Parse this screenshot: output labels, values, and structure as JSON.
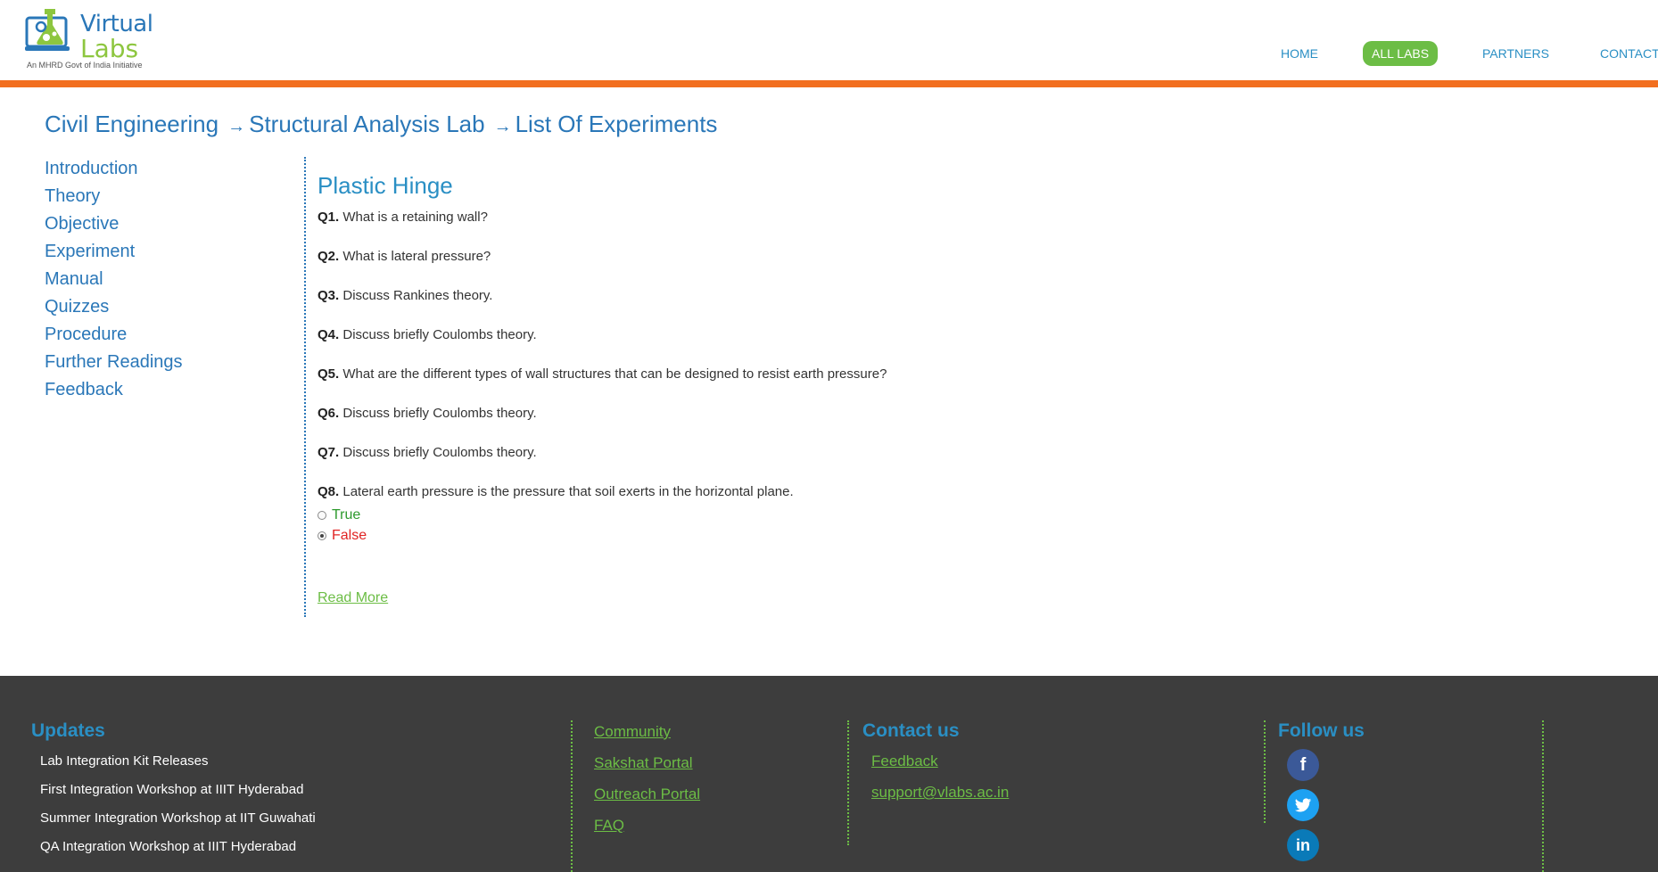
{
  "header": {
    "logo": {
      "line1": "Virtual",
      "line2": "Labs",
      "tagline": "An MHRD Govt of India Initiative"
    },
    "nav": [
      {
        "label": "HOME",
        "active": false
      },
      {
        "label": "ALL LABS",
        "active": true
      },
      {
        "label": "PARTNERS",
        "active": false
      },
      {
        "label": "CONTACT",
        "active": false
      }
    ]
  },
  "breadcrumb": {
    "items": [
      "Civil Engineering",
      "Structural Analysis Lab",
      "List Of Experiments"
    ],
    "separator": "→"
  },
  "sidebar": {
    "items": [
      "Introduction",
      "Theory",
      "Objective",
      "Experiment",
      "Manual",
      "Quizzes",
      "Procedure",
      "Further Readings",
      "Feedback"
    ]
  },
  "content": {
    "title": "Plastic Hinge",
    "questions": [
      {
        "num": "Q1.",
        "text": "What is a retaining wall?"
      },
      {
        "num": "Q2.",
        "text": "What is lateral pressure?"
      },
      {
        "num": "Q3.",
        "text": "Discuss Rankines theory."
      },
      {
        "num": "Q4.",
        "text": "Discuss briefly Coulombs theory."
      },
      {
        "num": "Q5.",
        "text": "What are the different types of wall structures that can be designed to resist earth pressure?"
      },
      {
        "num": "Q6.",
        "text": "Discuss briefly Coulombs theory."
      },
      {
        "num": "Q7.",
        "text": "Discuss briefly Coulombs theory."
      },
      {
        "num": "Q8.",
        "text": "Lateral earth pressure is the pressure that soil exerts in the horizontal plane."
      }
    ],
    "options": [
      {
        "label": "True",
        "checked": false
      },
      {
        "label": "False",
        "checked": true
      }
    ],
    "read_more": "Read More"
  },
  "footer": {
    "updates": {
      "title": "Updates",
      "items": [
        "Lab Integration Kit Releases",
        "First Integration Workshop at IIIT Hyderabad",
        "Summer Integration Workshop at IIT Guwahati",
        "QA Integration Workshop at IIIT Hyderabad"
      ]
    },
    "links": [
      "Community",
      "Sakshat Portal",
      "Outreach Portal",
      "FAQ"
    ],
    "contact": {
      "title": "Contact us",
      "items": [
        "Feedback",
        "support@vlabs.ac.in"
      ]
    },
    "follow": {
      "title": "Follow us",
      "icons": [
        "facebook-icon",
        "twitter-icon",
        "linkedin-icon"
      ]
    }
  },
  "colors": {
    "brand_blue": "#2a77b8",
    "accent_green": "#6cbd45",
    "header_orange": "#f26f1f",
    "footer_bg": "#3d3d3d"
  }
}
